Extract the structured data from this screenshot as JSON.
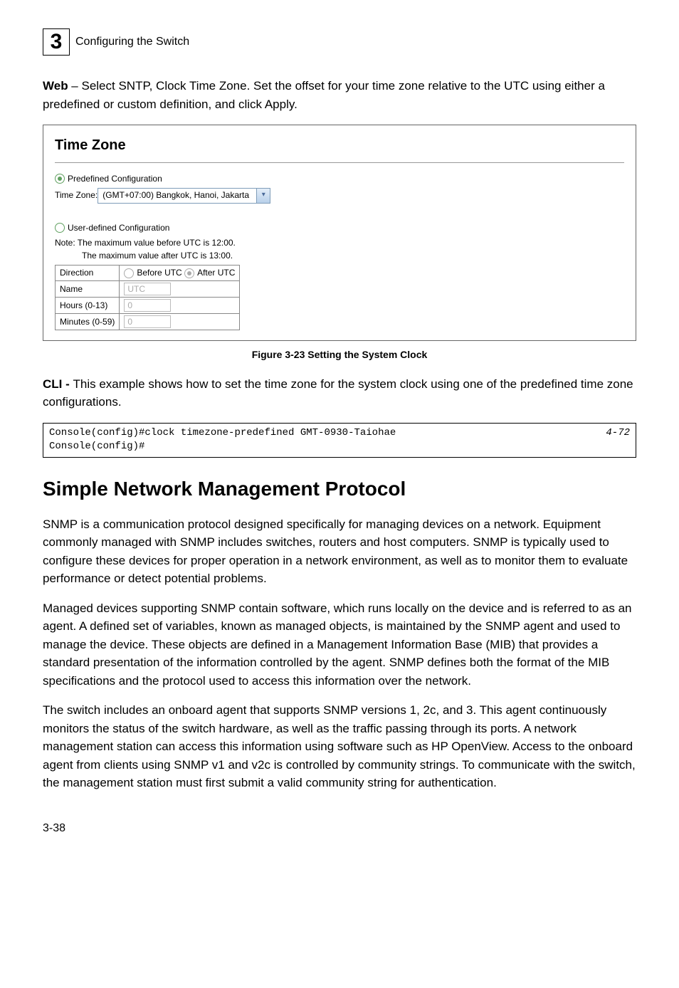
{
  "chapter": {
    "number": "3",
    "title": "Configuring the Switch"
  },
  "intro": {
    "label": "Web",
    "text": " – Select SNTP, Clock Time Zone. Set the offset for your time zone relative to the UTC using either a predefined or custom definition, and click Apply."
  },
  "screenshot": {
    "title": "Time Zone",
    "predefined_label": " Predefined Configuration",
    "zone_label": "Time Zone: ",
    "zone_value": "(GMT+07:00) Bangkok, Hanoi, Jakarta",
    "user_label": " User-defined Configuration",
    "note1": "Note: The maximum value before UTC is 12:00.",
    "note2": "The maximum value after UTC is 13:00.",
    "tbl": {
      "direction": "Direction",
      "before": "Before UTC ",
      "after": "After UTC",
      "name": "Name",
      "name_val": "UTC",
      "hours": "Hours (0-13)",
      "hours_val": "0",
      "minutes": "Minutes (0-59)",
      "minutes_val": "0"
    }
  },
  "figure_caption": "Figure 3-23  Setting the System Clock",
  "cli": {
    "label": "CLI - ",
    "text": "This example shows how to set the time zone for the system clock using one of the predefined time zone configurations.",
    "line1": "Console(config)#clock timezone-predefined GMT-0930-Taiohae",
    "line2": "Console(config)#",
    "ref": "4-72"
  },
  "section_title": "Simple Network Management Protocol",
  "para1": "SNMP is a communication protocol designed specifically for managing devices on a network. Equipment commonly managed with SNMP includes switches, routers and host computers. SNMP is typically used to configure these devices for proper operation in a network environment, as well as to monitor them to evaluate performance or detect potential problems.",
  "para2": "Managed devices supporting SNMP contain software, which runs locally on the device and is referred to as an agent. A defined set of variables, known as managed objects, is maintained by the SNMP agent and used to manage the device. These objects are defined in a Management Information Base (MIB) that provides a standard presentation of the information controlled by the agent. SNMP defines both the format of the MIB specifications and the protocol used to access this information over the network.",
  "para3": "The switch includes an onboard agent that supports SNMP versions 1, 2c, and 3. This agent continuously monitors the status of the switch hardware, as well as the traffic passing through its ports. A network management station can access this information using software such as HP OpenView. Access to the onboard agent from clients using SNMP v1 and v2c is controlled by community strings. To communicate with the switch, the management station must first submit a valid community string for authentication.",
  "pagenum": "3-38"
}
